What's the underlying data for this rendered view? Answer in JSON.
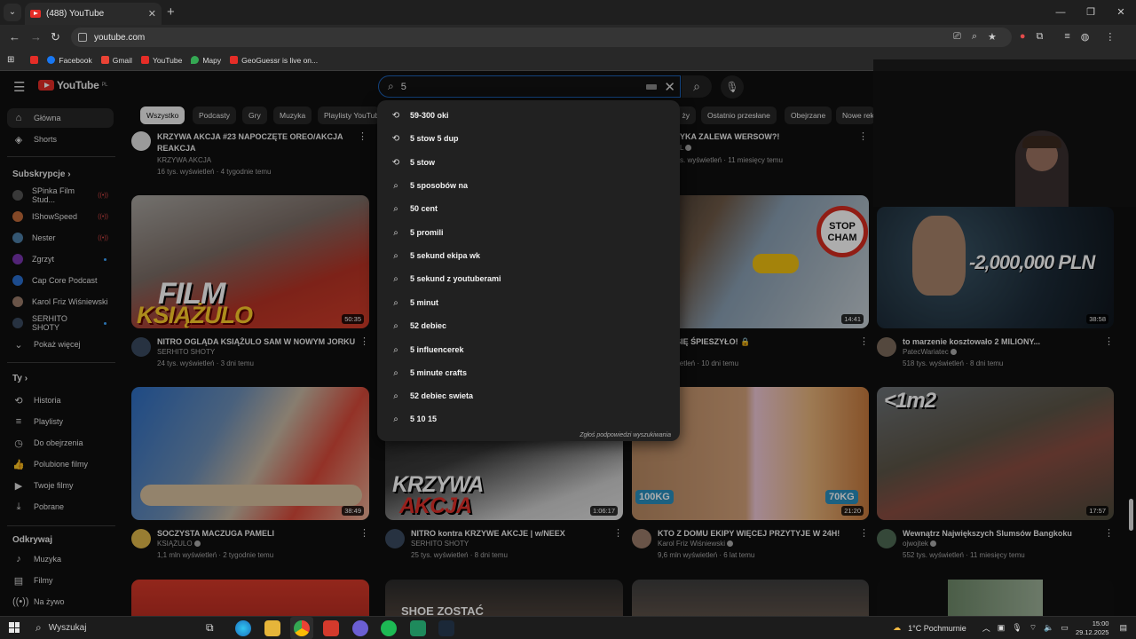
{
  "browser": {
    "tab_title": "(488) YouTube",
    "url": "youtube.com",
    "bookmarks": [
      {
        "label": "",
        "color": "#e52d27"
      },
      {
        "label": "Facebook",
        "color": "#1877f2"
      },
      {
        "label": "Gmail",
        "color": "#ea4335"
      },
      {
        "label": "YouTube",
        "color": "#e52d27"
      },
      {
        "label": "Mapy",
        "color": "#34a853"
      },
      {
        "label": "GeoGuessr is live on...",
        "color": "#e52d27"
      }
    ]
  },
  "youtube": {
    "logo_text": "YouTube",
    "logo_region": "PL",
    "search_value": "5",
    "chips": [
      "Wszystko",
      "Podcasty",
      "Gry",
      "Muzyka",
      "Playlisty YouTube",
      "Ostatnio przesłane",
      "Obejrzane",
      "Nowe rek"
    ]
  },
  "sidebar": {
    "main": [
      {
        "label": "Główna",
        "icon": "home-icon"
      },
      {
        "label": "Shorts",
        "icon": "shorts-icon"
      }
    ],
    "subs_header": "Subskrypcje",
    "subs": [
      {
        "label": "SPinka Film Stud...",
        "color": "#555555",
        "status": "live"
      },
      {
        "label": "IShowSpeed",
        "color": "#c26b3a",
        "status": "live"
      },
      {
        "label": "Nester",
        "color": "#4d7fa8",
        "status": "live"
      },
      {
        "label": "Zgrzyt",
        "color": "#7a35b0",
        "status": "dot"
      },
      {
        "label": "Cap Core Podcast",
        "color": "#2a6fd0",
        "status": ""
      },
      {
        "label": "Karol Friz Wiśniewski",
        "color": "#9b7d6b",
        "status": ""
      },
      {
        "label": "SERHITO SHOTY",
        "color": "#3a4a60",
        "status": "dot"
      }
    ],
    "show_more": "Pokaż więcej",
    "you_header": "Ty",
    "you": [
      {
        "label": "Historia",
        "icon": "history-icon"
      },
      {
        "label": "Playlisty",
        "icon": "playlists-icon"
      },
      {
        "label": "Do obejrzenia",
        "icon": "watch-later-icon"
      },
      {
        "label": "Polubione filmy",
        "icon": "liked-icon"
      },
      {
        "label": "Twoje filmy",
        "icon": "your-videos-icon"
      },
      {
        "label": "Pobrane",
        "icon": "downloads-icon"
      }
    ],
    "explore_header": "Odkrywaj",
    "explore": [
      {
        "label": "Muzyka",
        "icon": "music-icon"
      },
      {
        "label": "Filmy",
        "icon": "movies-icon"
      },
      {
        "label": "Na żywo",
        "icon": "live-icon"
      }
    ]
  },
  "top_row": {
    "left_title_1": "KRZYWA AKCJA #23   NAPOCZĘTE OREO/AKCJA",
    "left_title_2": "REAKCJA",
    "left_channel": "KRZYWA AKCJA",
    "left_stats": "16 tys. wyświetleń · 4 tygodnie temu",
    "right_title": "YKA ZALEWA WERSOW?!",
    "right_channel": "L",
    "right_stats": "s. wyświetleń · 11 miesięcy temu"
  },
  "videos": [
    {
      "title": "NITRO OGLĄDA KSIĄŻULO SAM W NOWYM JORKU",
      "channel": "SERHITO SHOTY",
      "stats": "24 tys. wyświetleń · 3 dni temu",
      "duration": "50:35",
      "overlay1": "FILM",
      "overlay2": "KSIĄŻULO",
      "bg": "#8b2b22",
      "verified": false
    },
    {
      "title": "A MU SIĘ ŚPIESZYŁO! 🔒",
      "channel": "",
      "stats": "s. wyświetleń · 10 dni temu",
      "duration": "14:41",
      "overlay1": "STOP",
      "overlay2": "CHAM",
      "bg": "#6b7c8a",
      "verified": true
    },
    {
      "title": "to marzenie kosztowało 2 MILIONY...",
      "channel": "PatecWariatec",
      "stats": "518 tys. wyświetleń · 8 dni temu",
      "duration": "38:58",
      "overlay1": "-2,000,000 PLN",
      "overlay2": "",
      "bg": "#2a3b4a",
      "verified": true
    },
    {
      "title": "SOCZYSTA MACZUGA PAMELI",
      "channel": "KSIĄŻULO",
      "stats": "1,1 mln wyświetleń · 2 tygodnie temu",
      "duration": "38:49",
      "overlay1": "",
      "overlay2": "",
      "bg": "#5a6f8f",
      "verified": true
    },
    {
      "title": "NITRO kontra KRZYWE AKCJE | w/NEEX",
      "channel": "SERHITO SHOTY",
      "stats": "25 tys. wyświetleń · 8 dni temu",
      "duration": "1:06:17",
      "overlay1": "KRZYWA",
      "overlay2": "AKCJA",
      "bg": "#3a3a3a",
      "verified": false
    },
    {
      "title": "KTO Z DOMU EKIPY WIĘCEJ PRZYTYJE W 24H!",
      "channel": "Karol Friz Wiśniewski",
      "stats": "9,6 mln wyświetleń · 6 lat temu",
      "duration": "21:20",
      "overlay1": "100KG",
      "overlay2": "70KG",
      "bg": "#b8784a",
      "verified": true
    },
    {
      "title": "Wewnątrz Największych Slumsów Bangkoku",
      "channel": "ojwojtek",
      "stats": "552 tys. wyświetleń · 11 miesięcy temu",
      "duration": "17:57",
      "overlay1": "<1m2",
      "overlay2": "",
      "bg": "#5f5a4c",
      "verified": true
    }
  ],
  "suggestions": [
    {
      "text": "59-300 oki",
      "icon": "history-icon"
    },
    {
      "text": "5 stow 5 dup",
      "icon": "history-icon"
    },
    {
      "text": "5 stow",
      "icon": "history-icon"
    },
    {
      "text": "5 sposobów na",
      "icon": "search-icon"
    },
    {
      "text": "50 cent",
      "icon": "search-icon"
    },
    {
      "text": "5 promili",
      "icon": "search-icon"
    },
    {
      "text": "5 sekund ekipa wk",
      "icon": "search-icon"
    },
    {
      "text": "5 sekund z youtuberami",
      "icon": "search-icon"
    },
    {
      "text": "5 minut",
      "icon": "search-icon"
    },
    {
      "text": "52 debiec",
      "icon": "search-icon"
    },
    {
      "text": "5 influencerek",
      "icon": "search-icon"
    },
    {
      "text": "5 minute crafts",
      "icon": "search-icon"
    },
    {
      "text": "52 debiec swieta",
      "icon": "search-icon"
    },
    {
      "text": "5 10 15",
      "icon": "search-icon"
    }
  ],
  "suggest_footer": "Zgłoś podpowiedzi wyszukiwania",
  "bottom_overlays": [
    "",
    "SHOE ZOSTAĆ"
  ],
  "taskbar": {
    "search_label": "Wyszukaj",
    "weather": "1°C  Pochmurnie",
    "time": "15:00",
    "date": "29.12.2025"
  }
}
